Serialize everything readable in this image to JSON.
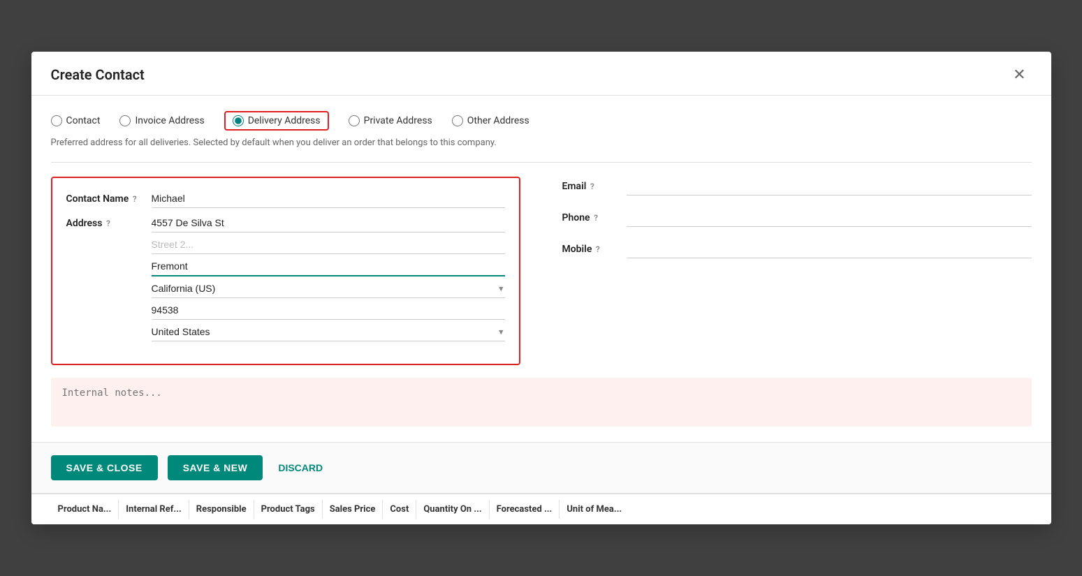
{
  "modal": {
    "title": "Create Contact",
    "close_label": "✕"
  },
  "address_types": [
    {
      "id": "contact",
      "label": "Contact",
      "checked": false
    },
    {
      "id": "invoice",
      "label": "Invoice Address",
      "checked": false
    },
    {
      "id": "delivery",
      "label": "Delivery Address",
      "checked": true
    },
    {
      "id": "private",
      "label": "Private Address",
      "checked": false
    },
    {
      "id": "other",
      "label": "Other Address",
      "checked": false
    }
  ],
  "description": "Preferred address for all deliveries. Selected by default when you deliver an order that belongs to this company.",
  "form": {
    "contact_name_label": "Contact Name",
    "contact_name_value": "Michael",
    "address_label": "Address",
    "street_value": "4557 De Silva St",
    "street2_placeholder": "Street 2...",
    "city_value": "Fremont",
    "state_value": "California (US)",
    "zip_value": "94538",
    "country_value": "United States",
    "email_label": "Email",
    "email_value": "",
    "phone_label": "Phone",
    "phone_value": "",
    "mobile_label": "Mobile",
    "mobile_value": "",
    "notes_placeholder": "Internal notes..."
  },
  "footer": {
    "save_close": "SAVE & CLOSE",
    "save_new": "SAVE & NEW",
    "discard": "DISCARD"
  },
  "bottom_bar": {
    "columns": [
      "Product Na...",
      "Internal Ref...",
      "Responsible",
      "Product Tags",
      "Sales Price",
      "Cost",
      "Quantity On ...",
      "Forecasted ...",
      "Unit of Mea..."
    ]
  }
}
